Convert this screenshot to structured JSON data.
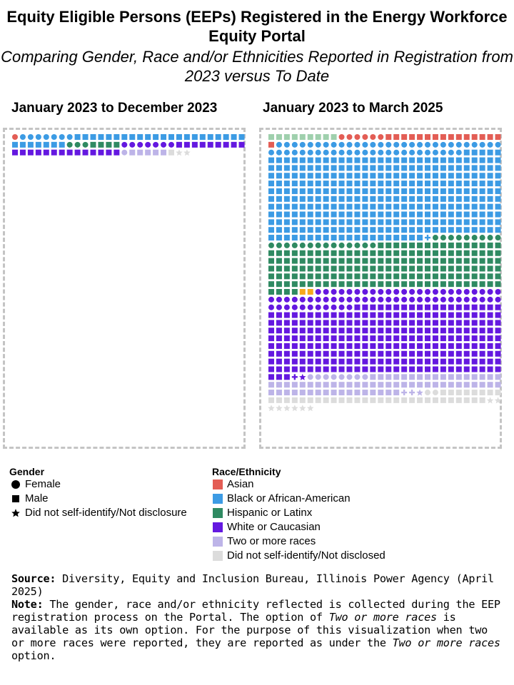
{
  "title": "Equity Eligible Persons (EEPs) Registered in the Energy Workforce Equity Portal",
  "subtitle": "Comparing Gender, Race and/or Ethnicities Reported in Registration from 2023 versus To Date",
  "colors": {
    "Asian": "#e35d55",
    "Black or African-American": "#3c9be4",
    "Hispanic or Latinx": "#2f8a62",
    "White or Caucasian": "#6418e0",
    "Two or more races": "#bdb4e8",
    "Did not self-identify/Not disclosed": "#dcdcdc",
    "Unlabeled light green": "#9fd0ad",
    "Unlabeled orange": "#f6a81c"
  },
  "legend": {
    "gender_title": "Gender",
    "gender": [
      {
        "label": "Female",
        "shape": "circle"
      },
      {
        "label": "Male",
        "shape": "square"
      },
      {
        "label": "Did not self-identify/Not disclosure",
        "shape": "star"
      }
    ],
    "race_title": "Race/Ethnicity",
    "race": [
      {
        "label": "Asian",
        "color": "#e35d55"
      },
      {
        "label": "Black or African-American",
        "color": "#3c9be4"
      },
      {
        "label": "Hispanic or Latinx",
        "color": "#2f8a62"
      },
      {
        "label": "White or Caucasian",
        "color": "#6418e0"
      },
      {
        "label": "Two or more races",
        "color": "#bdb4e8"
      },
      {
        "label": "Did not self-identify/Not disclosed",
        "color": "#dcdcdc"
      }
    ]
  },
  "notes": {
    "source_label": "Source:",
    "source_text": " Diversity, Equity and Inclusion Bureau, Illinois Power Agency (April 2025)",
    "note_label": "Note:",
    "note_text_1": " The gender, race and/or ethnicity reflected is collected during the EEP registration process on the Portal. The option of ",
    "note_italic_1": "Two or more races",
    "note_text_2": " is available as its own option. For the purpose of this visualization when two or more races were reported, they are reported as under the ",
    "note_italic_2": "Two or more races",
    "note_text_3": " option."
  },
  "chart_data": [
    {
      "type": "waffle",
      "title": "January 2023 to December 2023",
      "columns": 30,
      "unit": "one registered EEP per mark; color = race/ethnicity, shape = gender",
      "runs": [
        {
          "race": "Asian",
          "gender": "circle",
          "count": 1
        },
        {
          "race": "Black or African-American",
          "gender": "circle",
          "count": 7
        },
        {
          "race": "Black or African-American",
          "gender": "square",
          "count": 29
        },
        {
          "race": "Hispanic or Latinx",
          "gender": "circle",
          "count": 3
        },
        {
          "race": "Hispanic or Latinx",
          "gender": "square",
          "count": 4
        },
        {
          "race": "White or Caucasian",
          "gender": "circle",
          "count": 7
        },
        {
          "race": "White or Caucasian",
          "gender": "square",
          "count": 23
        },
        {
          "race": "Two or more races",
          "gender": "circle",
          "count": 1
        },
        {
          "race": "Two or more races",
          "gender": "square",
          "count": 5
        },
        {
          "race": "Did not self-identify/Not disclosed",
          "gender": "square",
          "count": 1
        },
        {
          "race": "Did not self-identify/Not disclosed",
          "gender": "star",
          "count": 2
        }
      ],
      "total": 83
    },
    {
      "type": "waffle",
      "title": "January 2023 to March 2025",
      "columns": 30,
      "unit": "one registered EEP per mark; color = race/ethnicity, shape = gender",
      "runs": [
        {
          "race": "Unlabeled light green",
          "gender": "square",
          "count": 9
        },
        {
          "race": "Asian",
          "gender": "circle",
          "count": 6
        },
        {
          "race": "Asian",
          "gender": "square",
          "count": 16
        },
        {
          "race": "Black or African-American",
          "gender": "circle",
          "count": 54
        },
        {
          "race": "Black or African-American",
          "gender": "square",
          "count": 325
        },
        {
          "race": "Black or African-American",
          "gender": "plus",
          "count": 1
        },
        {
          "race": "Hispanic or Latinx",
          "gender": "circle",
          "count": 23
        },
        {
          "race": "Hispanic or Latinx",
          "gender": "square",
          "count": 170
        },
        {
          "race": "Unlabeled orange",
          "gender": "square",
          "count": 2
        },
        {
          "race": "White or Caucasian",
          "gender": "circle",
          "count": 65
        },
        {
          "race": "White or Caucasian",
          "gender": "square",
          "count": 262
        },
        {
          "race": "White or Caucasian",
          "gender": "plus",
          "count": 1
        },
        {
          "race": "White or Caucasian",
          "gender": "star",
          "count": 1
        },
        {
          "race": "Two or more races",
          "gender": "circle",
          "count": 8
        },
        {
          "race": "Two or more races",
          "gender": "square",
          "count": 64
        },
        {
          "race": "Two or more races",
          "gender": "plus",
          "count": 2
        },
        {
          "race": "Two or more races",
          "gender": "star",
          "count": 1
        },
        {
          "race": "Did not self-identify/Not disclosed",
          "gender": "circle",
          "count": 2
        },
        {
          "race": "Did not self-identify/Not disclosed",
          "gender": "square",
          "count": 36
        },
        {
          "race": "Did not self-identify/Not disclosed",
          "gender": "star",
          "count": 8
        }
      ],
      "total": 1056
    }
  ]
}
